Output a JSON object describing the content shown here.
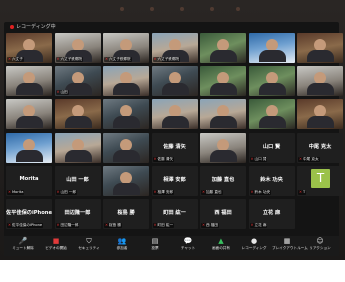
{
  "window": {
    "recording_label": "レコーディング中"
  },
  "tiles": [
    {
      "label": "六丈子",
      "style": "video e",
      "kind": "video"
    },
    {
      "label": "六丈子鉄郷院",
      "style": "video c",
      "kind": "video"
    },
    {
      "label": "六丈子鉄郷院",
      "style": "video c",
      "kind": "video"
    },
    {
      "label": "六丈子鉄郷院",
      "style": "video a",
      "kind": "video"
    },
    {
      "label": "",
      "style": "video b",
      "kind": "video"
    },
    {
      "label": "",
      "style": "video d",
      "kind": "video"
    },
    {
      "label": "",
      "style": "video e",
      "kind": "video"
    },
    {
      "label": "",
      "style": "video c",
      "kind": "video"
    },
    {
      "label": "山田",
      "style": "video",
      "kind": "video"
    },
    {
      "label": "",
      "style": "video a",
      "kind": "video"
    },
    {
      "label": "",
      "style": "video",
      "kind": "video"
    },
    {
      "label": "",
      "style": "video b",
      "kind": "video"
    },
    {
      "label": "",
      "style": "video b",
      "kind": "video"
    },
    {
      "label": "",
      "style": "video c",
      "kind": "video"
    },
    {
      "label": "",
      "style": "video c",
      "kind": "video"
    },
    {
      "label": "",
      "style": "video e",
      "kind": "video"
    },
    {
      "label": "",
      "style": "video",
      "kind": "video"
    },
    {
      "label": "",
      "style": "video a",
      "kind": "video"
    },
    {
      "label": "",
      "style": "video a",
      "kind": "video"
    },
    {
      "label": "",
      "style": "video b",
      "kind": "video"
    },
    {
      "label": "",
      "style": "video e",
      "kind": "video"
    },
    {
      "label": "",
      "style": "video d",
      "kind": "video"
    },
    {
      "label": "",
      "style": "video a",
      "kind": "video"
    },
    {
      "label": "",
      "style": "video",
      "kind": "video"
    },
    {
      "label": "佐藤 清矢",
      "style": "blank",
      "kind": "name",
      "center": "佐藤 清矢"
    },
    {
      "label": "",
      "style": "video c",
      "kind": "video"
    },
    {
      "label": "山口 賢",
      "style": "blank",
      "kind": "name",
      "center": "山口 賢"
    },
    {
      "label": "中尾 克太",
      "style": "blank",
      "kind": "name",
      "center": "中尾 克太"
    },
    {
      "label": "Morita",
      "style": "blank",
      "kind": "name",
      "center": "Morita"
    },
    {
      "label": "山田 一郎",
      "style": "blank",
      "kind": "name",
      "center": "山田 一郎"
    },
    {
      "label": "",
      "style": "video",
      "kind": "video"
    },
    {
      "label": "相澤 安郎",
      "style": "blank",
      "kind": "name",
      "center": "相澤 安郎"
    },
    {
      "label": "加藤 直也",
      "style": "blank",
      "kind": "name",
      "center": "加藤 直也"
    },
    {
      "label": "鈴木 功央",
      "style": "blank",
      "kind": "name",
      "center": "鈴木 功央"
    },
    {
      "label": "T",
      "style": "initial",
      "kind": "initial",
      "initial": "T"
    },
    {
      "label": "佐平佳保のiPhone",
      "style": "blank",
      "kind": "name",
      "center": "佐平佳保のiPhone"
    },
    {
      "label": "田辺隆一郎",
      "style": "blank",
      "kind": "name",
      "center": "田辺隆一郎"
    },
    {
      "label": "桜島 勝",
      "style": "blank",
      "kind": "name",
      "center": "桜島 勝"
    },
    {
      "label": "町田 紘一",
      "style": "blank",
      "kind": "name",
      "center": "町田 紘一"
    },
    {
      "label": "西 福田",
      "style": "blank",
      "kind": "name",
      "center": "西 福田"
    },
    {
      "label": "立花 麻",
      "style": "blank",
      "kind": "name",
      "center": "立花 麻"
    }
  ],
  "toolbar": [
    {
      "name": "mute-button",
      "icon": "🎤",
      "label": "ミュート解除",
      "tone": "red"
    },
    {
      "name": "video-button",
      "icon": "■",
      "label": "ビデオの開始",
      "tone": "red"
    },
    {
      "name": "security-button",
      "icon": "⛉",
      "label": "セキュリティ",
      "tone": ""
    },
    {
      "name": "participants-button",
      "icon": "👥",
      "label": "参加者",
      "tone": ""
    },
    {
      "name": "poll-button",
      "icon": "▤",
      "label": "投票",
      "tone": ""
    },
    {
      "name": "chat-button",
      "icon": "💬",
      "label": "チャット",
      "tone": ""
    },
    {
      "name": "share-screen-button",
      "icon": "▲",
      "label": "画面の共有",
      "tone": "green"
    },
    {
      "name": "record-button",
      "icon": "●",
      "label": "レコーディング",
      "tone": ""
    },
    {
      "name": "breakout-button",
      "icon": "▦",
      "label": "ブレイクアウトルーム",
      "tone": ""
    },
    {
      "name": "reactions-button",
      "icon": "☺",
      "label": "リアクション",
      "tone": ""
    }
  ]
}
